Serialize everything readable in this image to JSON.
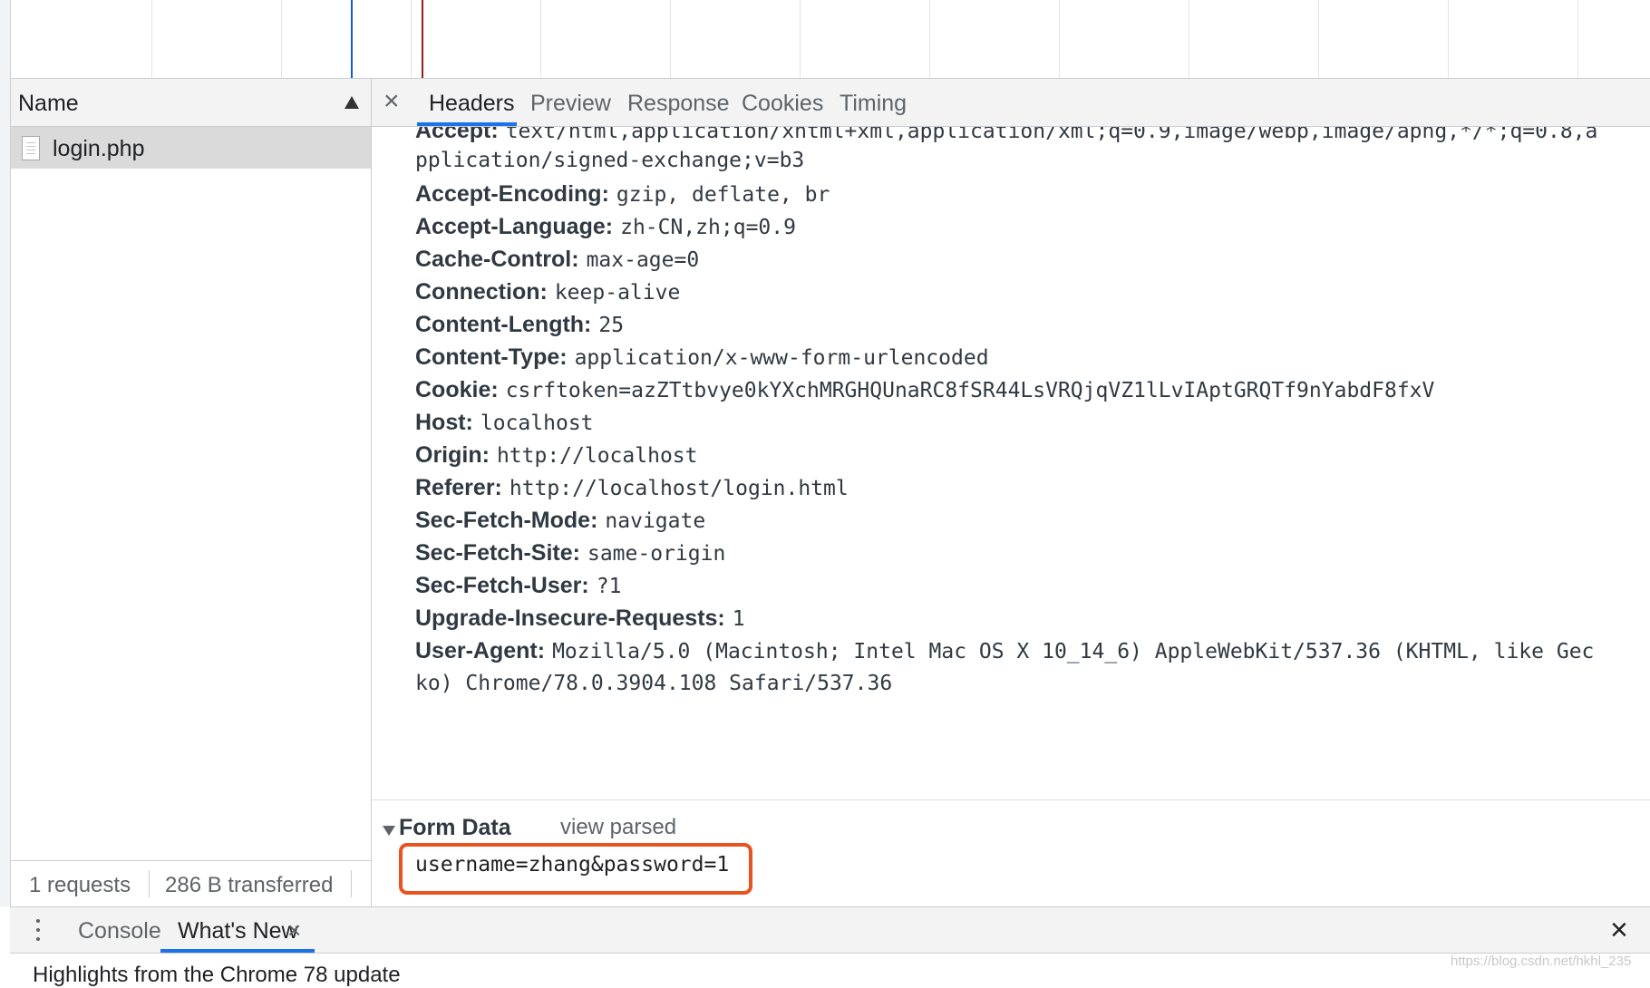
{
  "name_panel": {
    "header_label": "Name",
    "rows": [
      {
        "name": "login.php"
      }
    ],
    "status": {
      "requests": "1 requests",
      "transferred": "286 B transferred"
    }
  },
  "detail": {
    "close_glyph": "×",
    "tabs": [
      {
        "label": "Headers",
        "active": true
      },
      {
        "label": "Preview",
        "active": false
      },
      {
        "label": "Response",
        "active": false
      },
      {
        "label": "Cookies",
        "active": false
      },
      {
        "label": "Timing",
        "active": false
      }
    ],
    "request_headers": [
      {
        "name": "Accept:",
        "value": "text/html,application/xhtml+xml,application/xml;q=0.9,image/webp,image/apng,*/*;q=0.8,a"
      },
      {
        "name": "",
        "value": "pplication/signed-exchange;v=b3"
      },
      {
        "name": "Accept-Encoding:",
        "value": "gzip, deflate, br"
      },
      {
        "name": "Accept-Language:",
        "value": "zh-CN,zh;q=0.9"
      },
      {
        "name": "Cache-Control:",
        "value": "max-age=0"
      },
      {
        "name": "Connection:",
        "value": "keep-alive"
      },
      {
        "name": "Content-Length:",
        "value": "25"
      },
      {
        "name": "Content-Type:",
        "value": "application/x-www-form-urlencoded"
      },
      {
        "name": "Cookie:",
        "value": "csrftoken=azZTtbvye0kYXchMRGHQUnaRC8fSR44LsVRQjqVZ1lLvIAptGRQTf9nYabdF8fxV"
      },
      {
        "name": "Host:",
        "value": "localhost"
      },
      {
        "name": "Origin:",
        "value": "http://localhost"
      },
      {
        "name": "Referer:",
        "value": "http://localhost/login.html"
      },
      {
        "name": "Sec-Fetch-Mode:",
        "value": "navigate"
      },
      {
        "name": "Sec-Fetch-Site:",
        "value": "same-origin"
      },
      {
        "name": "Sec-Fetch-User:",
        "value": "?1"
      },
      {
        "name": "Upgrade-Insecure-Requests:",
        "value": "1"
      },
      {
        "name": "User-Agent:",
        "value": "Mozilla/5.0 (Macintosh; Intel Mac OS X 10_14_6) AppleWebKit/537.36 (KHTML, like Gec"
      },
      {
        "name": "",
        "value": "ko) Chrome/78.0.3904.108 Safari/537.36"
      }
    ],
    "form_data": {
      "title": "Form Data",
      "toggle": "view parsed",
      "value": "username=zhang&password=1",
      "highlight_color": "#e8531f"
    }
  },
  "drawer": {
    "tabs": [
      {
        "label": "Console",
        "active": false
      },
      {
        "label": "What's New",
        "active": true,
        "closable": true
      }
    ],
    "close_glyph": "×",
    "content_text": "Highlights from the Chrome 78 update",
    "watermark": "https://blog.csdn.net/hkhl_235"
  },
  "colors": {
    "accent": "#1a73e8",
    "timeline_blue": "#1a56db",
    "timeline_red": "#9b1c1c"
  }
}
